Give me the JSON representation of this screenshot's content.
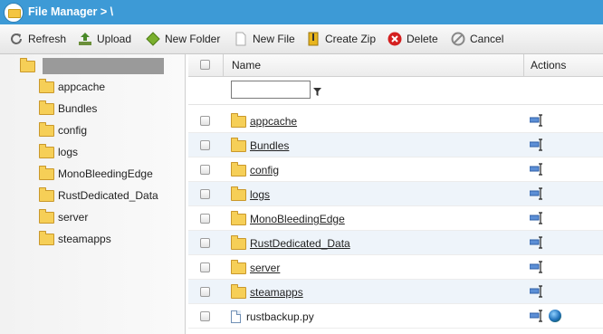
{
  "titlebar": {
    "title": "File Manager > \\",
    "icon": "file-manager-icon"
  },
  "toolbar": {
    "refresh": "Refresh",
    "upload": "Upload",
    "new_folder": "New Folder",
    "new_file": "New File",
    "create_zip": "Create Zip",
    "delete": "Delete",
    "cancel": "Cancel"
  },
  "tree": {
    "items": [
      {
        "label": "appcache"
      },
      {
        "label": "Bundles"
      },
      {
        "label": "config"
      },
      {
        "label": "logs"
      },
      {
        "label": "MonoBleedingEdge"
      },
      {
        "label": "RustDedicated_Data"
      },
      {
        "label": "server"
      },
      {
        "label": "steamapps"
      }
    ]
  },
  "grid": {
    "columns": {
      "name": "Name",
      "actions": "Actions"
    },
    "filter": {
      "value": ""
    },
    "rows": [
      {
        "name": "appcache",
        "type": "folder"
      },
      {
        "name": "Bundles",
        "type": "folder"
      },
      {
        "name": "config",
        "type": "folder"
      },
      {
        "name": "logs",
        "type": "folder"
      },
      {
        "name": "MonoBleedingEdge",
        "type": "folder"
      },
      {
        "name": "RustDedicated_Data",
        "type": "folder"
      },
      {
        "name": "server",
        "type": "folder"
      },
      {
        "name": "steamapps",
        "type": "folder"
      },
      {
        "name": "rustbackup.py",
        "type": "file"
      }
    ]
  },
  "colors": {
    "titlebar": "#3d9ad6",
    "row_alt": "#eef4fa",
    "folder": "#f6cf57"
  }
}
